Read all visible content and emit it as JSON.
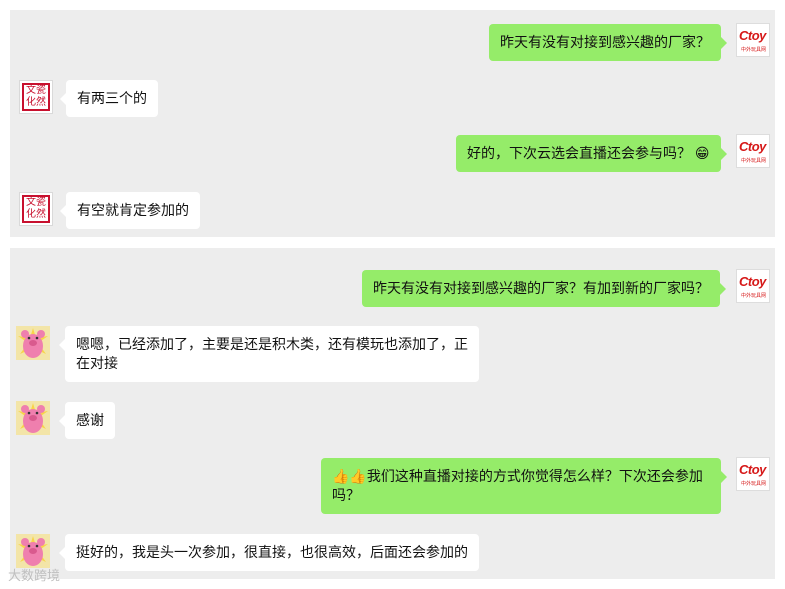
{
  "screen1": {
    "messages": [
      {
        "side": "right",
        "text": "昨天有没有对接到感兴趣的厂家？"
      },
      {
        "side": "left",
        "text": "有两三个的"
      },
      {
        "side": "right",
        "text": "好的，下次云选会直播还会参与吗？",
        "emoji": "😁"
      },
      {
        "side": "left",
        "text": "有空就肯定参加的"
      }
    ]
  },
  "screen2": {
    "messages": [
      {
        "side": "right",
        "text": "昨天有没有对接到感兴趣的厂家？有加到新的厂家吗？"
      },
      {
        "side": "left",
        "text": "嗯嗯，已经添加了，主要是还是积木类，还有模玩也添加了，正在对接"
      },
      {
        "side": "left",
        "text": "感谢"
      },
      {
        "side": "right",
        "emoji": "👍👍",
        "text": "我们这种直播对接的方式你觉得怎么样？下次还会参加吗？"
      },
      {
        "side": "left",
        "text": "挺好的，我是头一次参加，很直接，也很高效，后面还会参加的"
      }
    ]
  },
  "avatars": {
    "ctoy": {
      "logo": "Ctoy",
      "sub": "中外玩具网"
    },
    "wenyi": {
      "seal": "文藝化然"
    }
  },
  "watermark": "大数跨境"
}
